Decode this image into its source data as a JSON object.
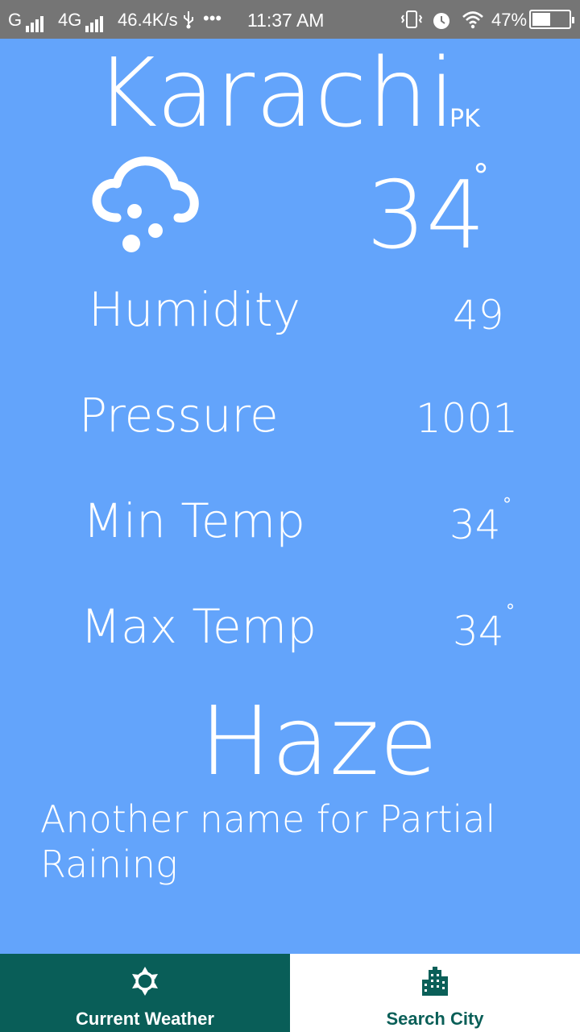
{
  "status_bar": {
    "carrier1": "G",
    "carrier2": "4G",
    "speed": "46.4K/s",
    "dots": "•••",
    "time": "11:37 AM",
    "battery": "47%"
  },
  "weather": {
    "city": "Karachi",
    "country": "PK",
    "icon": "cloud-hail-icon",
    "temperature": "34",
    "degree_symbol": "°",
    "humidity_label": "Humidity",
    "humidity_value": "49",
    "pressure_label": "Pressure",
    "pressure_value": "1001",
    "min_temp_label": "Min Temp",
    "min_temp_value": "34",
    "max_temp_label": "Max Temp",
    "max_temp_value": "34",
    "main": "Haze",
    "description": "Another name for Partial Raining"
  },
  "bottom_nav": {
    "items": [
      {
        "label": "Current Weather",
        "icon": "sun-gear-icon",
        "active": true
      },
      {
        "label": "Search City",
        "icon": "city-building-icon",
        "active": false
      }
    ]
  },
  "colors": {
    "background": "#63a4fb",
    "status_bar": "#757575",
    "nav_active": "#095e58",
    "nav_inactive": "#ffffff",
    "accent_text": "#0a5f58"
  }
}
